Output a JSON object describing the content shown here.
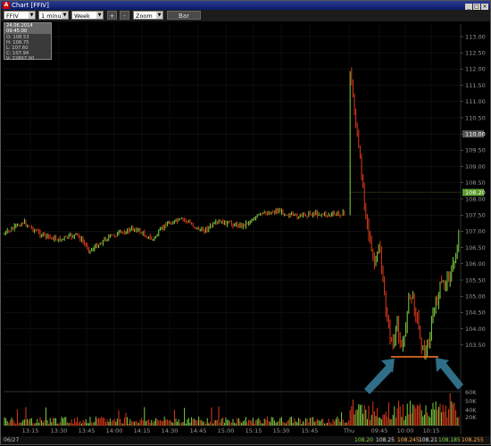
{
  "window": {
    "title": "Chart [FFIV]",
    "icon": "app-icon",
    "buttons": [
      "_",
      "□",
      "×"
    ]
  },
  "toolbar": {
    "symbol": "FFIV",
    "interval": "1 minute",
    "range": "Week",
    "plus": "+",
    "minus": "-",
    "zoom": "Zoom",
    "style": "Bar"
  },
  "ohlc": {
    "header": "24.06.2014 09:45:00",
    "open": "O: 108.53",
    "high": "H: 108.75",
    "low": "L: 107.60",
    "close": "C: 107.94",
    "volume": "V: 22807.00"
  },
  "price_axis": [
    "113.00",
    "112.50",
    "112.00",
    "111.50",
    "111.00",
    "110.50",
    "110.00",
    "109.50",
    "109.00",
    "108.50",
    "108.00",
    "107.50",
    "107.00",
    "106.50",
    "106.00",
    "105.50",
    "105.00",
    "104.50",
    "104.00",
    "103.50"
  ],
  "price_badges": {
    "mid": "110.00",
    "last": "108.20"
  },
  "volume_axis": [
    "60K",
    "50K",
    "40K",
    "20K"
  ],
  "time_axis": [
    "13:15",
    "13:30",
    "13:45",
    "14:00",
    "14:15",
    "14:30",
    "14:45",
    "15:00",
    "15:15",
    "15:30",
    "15:45",
    "Thu",
    "09:45",
    "10:00",
    "10:15"
  ],
  "status": {
    "date": "06/27",
    "values": [
      "108.20",
      "108.25",
      "108.245",
      "108.21",
      "108.185",
      "108.255"
    ]
  },
  "colors": {
    "up": "#7fd040",
    "down": "#e03a1a",
    "support": "#ff7a2a",
    "arrow": "#2f6e86"
  }
}
